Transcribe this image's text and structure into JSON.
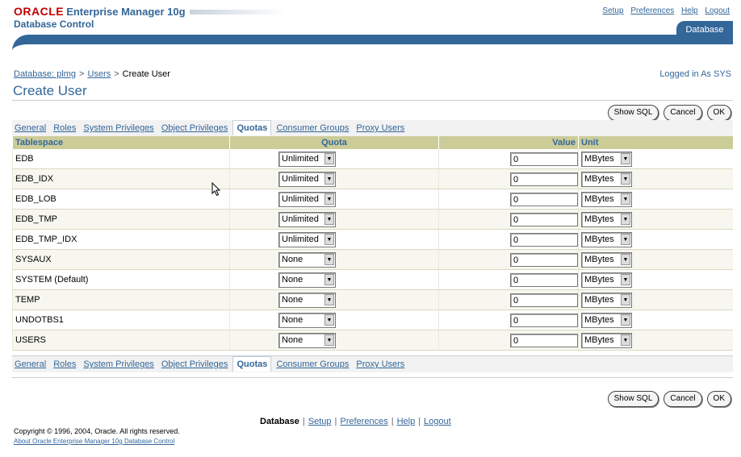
{
  "header": {
    "brand_oracle": "ORACLE",
    "brand_product": "Enterprise Manager 10g",
    "brand_sub": "Database Control",
    "global_links": [
      "Setup",
      "Preferences",
      "Help",
      "Logout"
    ],
    "active_tab": "Database"
  },
  "breadcrumb": {
    "items": [
      "Database: plmg",
      "Users",
      "Create User"
    ]
  },
  "logged_in": "Logged in As SYS",
  "page_title": "Create User",
  "buttons": {
    "show_sql": "Show SQL",
    "cancel": "Cancel",
    "ok": "OK"
  },
  "subtabs": {
    "items": [
      "General",
      "Roles",
      "System Privileges",
      "Object Privileges",
      "Quotas",
      "Consumer Groups",
      "Proxy Users"
    ],
    "selected": "Quotas"
  },
  "table": {
    "headers": [
      "Tablespace",
      "Quota",
      "Value",
      "Unit"
    ],
    "rows": [
      {
        "tablespace": "EDB",
        "quota": "Unlimited",
        "value": "0",
        "unit": "MBytes"
      },
      {
        "tablespace": "EDB_IDX",
        "quota": "Unlimited",
        "value": "0",
        "unit": "MBytes"
      },
      {
        "tablespace": "EDB_LOB",
        "quota": "Unlimited",
        "value": "0",
        "unit": "MBytes"
      },
      {
        "tablespace": "EDB_TMP",
        "quota": "Unlimited",
        "value": "0",
        "unit": "MBytes"
      },
      {
        "tablespace": "EDB_TMP_IDX",
        "quota": "Unlimited",
        "value": "0",
        "unit": "MBytes"
      },
      {
        "tablespace": "SYSAUX",
        "quota": "None",
        "value": "0",
        "unit": "MBytes"
      },
      {
        "tablespace": "SYSTEM (Default)",
        "quota": "None",
        "value": "0",
        "unit": "MBytes"
      },
      {
        "tablespace": "TEMP",
        "quota": "None",
        "value": "0",
        "unit": "MBytes"
      },
      {
        "tablespace": "UNDOTBS1",
        "quota": "None",
        "value": "0",
        "unit": "MBytes"
      },
      {
        "tablespace": "USERS",
        "quota": "None",
        "value": "0",
        "unit": "MBytes"
      }
    ]
  },
  "footer": {
    "links": [
      "Database",
      "Setup",
      "Preferences",
      "Help",
      "Logout"
    ],
    "copyright": "Copyright © 1996, 2004, Oracle. All rights reserved.",
    "about": "About Oracle Enterprise Manager 10g Database Control"
  },
  "colors": {
    "brand_blue": "#336699",
    "oracle_red": "#c00000",
    "header_tan": "#cccc99"
  }
}
